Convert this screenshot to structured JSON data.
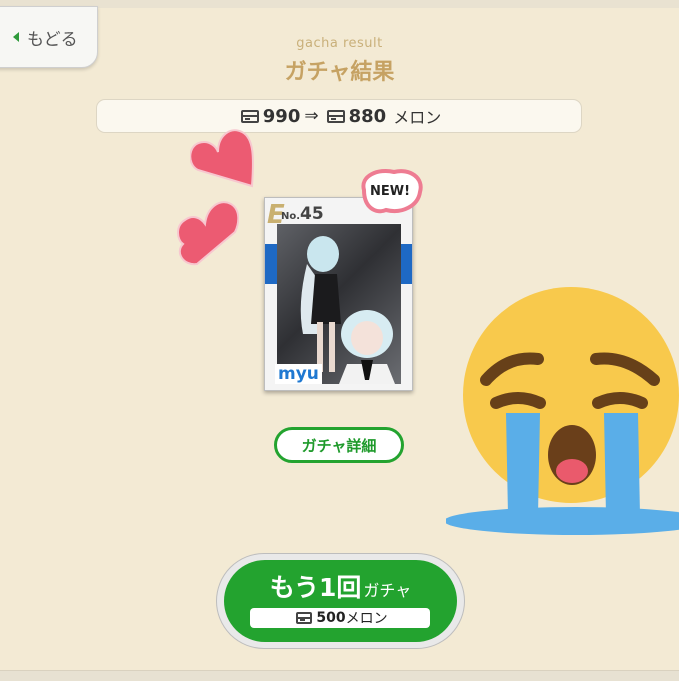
{
  "nav": {
    "back_label": "もどる"
  },
  "header": {
    "subtitle": "gacha result",
    "title": "ガチャ結果"
  },
  "price": {
    "before": "990",
    "arrow": "⇒",
    "after": "880",
    "unit": "メロン"
  },
  "card": {
    "rank": "E",
    "no_prefix": "No.",
    "number": "45",
    "name": "myu",
    "badge": "NEW!"
  },
  "buttons": {
    "detail_label": "ガチャ詳細",
    "retry_main": "もう1回",
    "retry_sub": "ガチャ",
    "retry_cost_value": "500",
    "retry_cost_unit": "メロン"
  },
  "overlays": {
    "hearts": "heart-icon",
    "emoji": "loudly-crying-face-icon"
  },
  "colors": {
    "accent_green": "#23a32f",
    "title_gold": "#c6a263",
    "card_blue": "#1e69c4",
    "heart_pink": "#ec5b72",
    "emoji_yellow": "#f8c94c",
    "tear_blue": "#5aaee8"
  }
}
